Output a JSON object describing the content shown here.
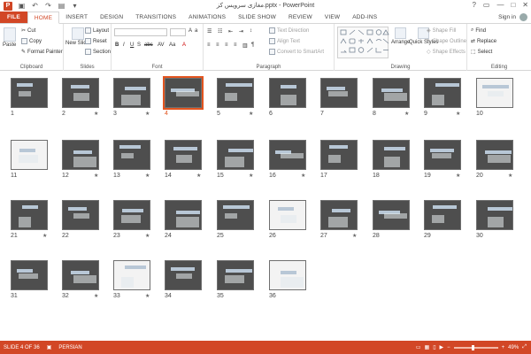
{
  "window": {
    "title": "مغازی سرویس کز.pptx - PowerPoint",
    "controls": [
      "?",
      "▭",
      "—",
      "□",
      "✕"
    ]
  },
  "tabs": [
    {
      "label": "FILE"
    },
    {
      "label": "HOME"
    },
    {
      "label": "INSERT"
    },
    {
      "label": "DESIGN"
    },
    {
      "label": "TRANSITIONS"
    },
    {
      "label": "ANIMATIONS"
    },
    {
      "label": "SLIDE SHOW"
    },
    {
      "label": "REVIEW"
    },
    {
      "label": "VIEW"
    },
    {
      "label": "ADD-INS"
    }
  ],
  "signin": "Sign in",
  "ribbon": {
    "clipboard": {
      "label": "Clipboard",
      "paste": "Paste",
      "cut": "Cut",
      "copy": "Copy",
      "format_painter": "Format Painter"
    },
    "slides": {
      "label": "Slides",
      "new_slide": "New Slide",
      "layout": "Layout",
      "reset": "Reset",
      "section": "Section"
    },
    "font": {
      "label": "Font"
    },
    "paragraph": {
      "label": "Paragraph",
      "text_direction": "Text Direction",
      "align_text": "Align Text",
      "convert": "Convert to SmartArt"
    },
    "drawing": {
      "label": "Drawing",
      "arrange": "Arrange",
      "quick_styles": "Quick Styles",
      "shape_fill": "Shape Fill",
      "shape_outline": "Shape Outline",
      "shape_effects": "Shape Effects"
    },
    "editing": {
      "label": "Editing",
      "find": "Find",
      "replace": "Replace",
      "select": "Select"
    }
  },
  "slides": [
    {
      "n": "1",
      "star": ""
    },
    {
      "n": "2",
      "star": "★"
    },
    {
      "n": "3",
      "star": "★"
    },
    {
      "n": "4",
      "star": ""
    },
    {
      "n": "5",
      "star": "★"
    },
    {
      "n": "6",
      "star": ""
    },
    {
      "n": "7",
      "star": ""
    },
    {
      "n": "8",
      "star": "★"
    },
    {
      "n": "9",
      "star": "★"
    },
    {
      "n": "10",
      "star": ""
    },
    {
      "n": "11",
      "star": ""
    },
    {
      "n": "12",
      "star": "★"
    },
    {
      "n": "13",
      "star": "★"
    },
    {
      "n": "14",
      "star": "★"
    },
    {
      "n": "15",
      "star": "★"
    },
    {
      "n": "16",
      "star": "★"
    },
    {
      "n": "17",
      "star": ""
    },
    {
      "n": "18",
      "star": ""
    },
    {
      "n": "19",
      "star": "★"
    },
    {
      "n": "20",
      "star": "★"
    },
    {
      "n": "21",
      "star": "★"
    },
    {
      "n": "22",
      "star": ""
    },
    {
      "n": "23",
      "star": "★"
    },
    {
      "n": "24",
      "star": ""
    },
    {
      "n": "25",
      "star": ""
    },
    {
      "n": "26",
      "star": ""
    },
    {
      "n": "27",
      "star": "★"
    },
    {
      "n": "28",
      "star": ""
    },
    {
      "n": "29",
      "star": ""
    },
    {
      "n": "30",
      "star": ""
    },
    {
      "n": "31",
      "star": ""
    },
    {
      "n": "32",
      "star": "★"
    },
    {
      "n": "33",
      "star": "★"
    },
    {
      "n": "34",
      "star": ""
    },
    {
      "n": "35",
      "star": ""
    },
    {
      "n": "36",
      "star": ""
    }
  ],
  "selected_slide": "4",
  "status": {
    "slide": "SLIDE 4 OF 36",
    "language": "PERSIAN",
    "zoom": "49%"
  },
  "colors": {
    "accent": "#d24726",
    "selection": "#e2541f"
  }
}
